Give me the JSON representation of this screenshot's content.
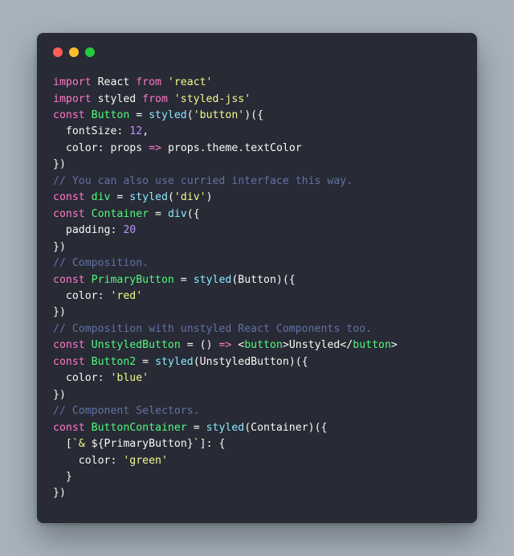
{
  "code": {
    "lines": [
      [
        {
          "t": "import ",
          "c": "k"
        },
        {
          "t": "React ",
          "c": "id"
        },
        {
          "t": "from ",
          "c": "k"
        },
        {
          "t": "'react'",
          "c": "s"
        }
      ],
      [
        {
          "t": "import ",
          "c": "k"
        },
        {
          "t": "styled ",
          "c": "id"
        },
        {
          "t": "from ",
          "c": "k"
        },
        {
          "t": "'styled-jss'",
          "c": "s"
        }
      ],
      [
        {
          "t": "const ",
          "c": "k"
        },
        {
          "t": "Button ",
          "c": "def"
        },
        {
          "t": "= ",
          "c": "p"
        },
        {
          "t": "styled",
          "c": "fn"
        },
        {
          "t": "(",
          "c": "p"
        },
        {
          "t": "'button'",
          "c": "s"
        },
        {
          "t": ")({",
          "c": "p"
        }
      ],
      [
        {
          "t": "  fontSize",
          "c": "id"
        },
        {
          "t": ": ",
          "c": "p"
        },
        {
          "t": "12",
          "c": "n"
        },
        {
          "t": ",",
          "c": "p"
        }
      ],
      [
        {
          "t": "  color",
          "c": "id"
        },
        {
          "t": ": ",
          "c": "p"
        },
        {
          "t": "props ",
          "c": "id"
        },
        {
          "t": "=> ",
          "c": "arr"
        },
        {
          "t": "props",
          "c": "id"
        },
        {
          "t": ".",
          "c": "p"
        },
        {
          "t": "theme",
          "c": "id"
        },
        {
          "t": ".",
          "c": "p"
        },
        {
          "t": "textColor",
          "c": "id"
        }
      ],
      [
        {
          "t": "})",
          "c": "p"
        }
      ],
      [
        {
          "t": "// You can also use curried interface this way.",
          "c": "c"
        }
      ],
      [
        {
          "t": "const ",
          "c": "k"
        },
        {
          "t": "div ",
          "c": "def"
        },
        {
          "t": "= ",
          "c": "p"
        },
        {
          "t": "styled",
          "c": "fn"
        },
        {
          "t": "(",
          "c": "p"
        },
        {
          "t": "'div'",
          "c": "s"
        },
        {
          "t": ")",
          "c": "p"
        }
      ],
      [
        {
          "t": "const ",
          "c": "k"
        },
        {
          "t": "Container ",
          "c": "def"
        },
        {
          "t": "= ",
          "c": "p"
        },
        {
          "t": "div",
          "c": "fn"
        },
        {
          "t": "({",
          "c": "p"
        }
      ],
      [
        {
          "t": "  padding",
          "c": "id"
        },
        {
          "t": ": ",
          "c": "p"
        },
        {
          "t": "20",
          "c": "n"
        }
      ],
      [
        {
          "t": "})",
          "c": "p"
        }
      ],
      [
        {
          "t": "// Composition.",
          "c": "c"
        }
      ],
      [
        {
          "t": "const ",
          "c": "k"
        },
        {
          "t": "PrimaryButton ",
          "c": "def"
        },
        {
          "t": "= ",
          "c": "p"
        },
        {
          "t": "styled",
          "c": "fn"
        },
        {
          "t": "(",
          "c": "p"
        },
        {
          "t": "Button",
          "c": "id"
        },
        {
          "t": ")({",
          "c": "p"
        }
      ],
      [
        {
          "t": "  color",
          "c": "id"
        },
        {
          "t": ": ",
          "c": "p"
        },
        {
          "t": "'red'",
          "c": "s"
        }
      ],
      [
        {
          "t": "})",
          "c": "p"
        }
      ],
      [
        {
          "t": "// Composition with unstyled React Components too.",
          "c": "c"
        }
      ],
      [
        {
          "t": "const ",
          "c": "k"
        },
        {
          "t": "UnstyledButton ",
          "c": "def"
        },
        {
          "t": "= ",
          "c": "p"
        },
        {
          "t": "() ",
          "c": "p"
        },
        {
          "t": "=> ",
          "c": "arr"
        },
        {
          "t": "<",
          "c": "p"
        },
        {
          "t": "button",
          "c": "attr"
        },
        {
          "t": ">",
          "c": "p"
        },
        {
          "t": "Unstyled",
          "c": "id"
        },
        {
          "t": "</",
          "c": "p"
        },
        {
          "t": "button",
          "c": "attr"
        },
        {
          "t": ">",
          "c": "p"
        }
      ],
      [
        {
          "t": "const ",
          "c": "k"
        },
        {
          "t": "Button2 ",
          "c": "def"
        },
        {
          "t": "= ",
          "c": "p"
        },
        {
          "t": "styled",
          "c": "fn"
        },
        {
          "t": "(",
          "c": "p"
        },
        {
          "t": "UnstyledButton",
          "c": "id"
        },
        {
          "t": ")({",
          "c": "p"
        }
      ],
      [
        {
          "t": "  color",
          "c": "id"
        },
        {
          "t": ": ",
          "c": "p"
        },
        {
          "t": "'blue'",
          "c": "s"
        }
      ],
      [
        {
          "t": "})",
          "c": "p"
        }
      ],
      [
        {
          "t": "// Component Selectors.",
          "c": "c"
        }
      ],
      [
        {
          "t": "const ",
          "c": "k"
        },
        {
          "t": "ButtonContainer ",
          "c": "def"
        },
        {
          "t": "= ",
          "c": "p"
        },
        {
          "t": "styled",
          "c": "fn"
        },
        {
          "t": "(",
          "c": "p"
        },
        {
          "t": "Container",
          "c": "id"
        },
        {
          "t": ")({",
          "c": "p"
        }
      ],
      [
        {
          "t": "  [",
          "c": "p"
        },
        {
          "t": "`& ",
          "c": "s"
        },
        {
          "t": "${",
          "c": "p"
        },
        {
          "t": "PrimaryButton",
          "c": "id"
        },
        {
          "t": "}",
          "c": "p"
        },
        {
          "t": "`",
          "c": "s"
        },
        {
          "t": "]: {",
          "c": "p"
        }
      ],
      [
        {
          "t": "    color",
          "c": "id"
        },
        {
          "t": ": ",
          "c": "p"
        },
        {
          "t": "'green'",
          "c": "s"
        }
      ],
      [
        {
          "t": "  }",
          "c": "p"
        }
      ],
      [
        {
          "t": "})",
          "c": "p"
        }
      ]
    ]
  }
}
